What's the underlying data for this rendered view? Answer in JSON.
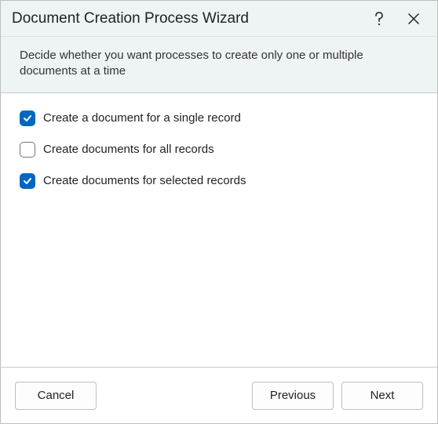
{
  "titlebar": {
    "title": "Document Creation Process Wizard"
  },
  "subheader": {
    "text": "Decide whether you want processes to create only one or multiple documents at a time"
  },
  "options": [
    {
      "label": "Create a document for a single record",
      "checked": true
    },
    {
      "label": "Create documents for all records",
      "checked": false
    },
    {
      "label": "Create documents for selected records",
      "checked": true
    }
  ],
  "footer": {
    "cancel": "Cancel",
    "previous": "Previous",
    "next": "Next"
  }
}
